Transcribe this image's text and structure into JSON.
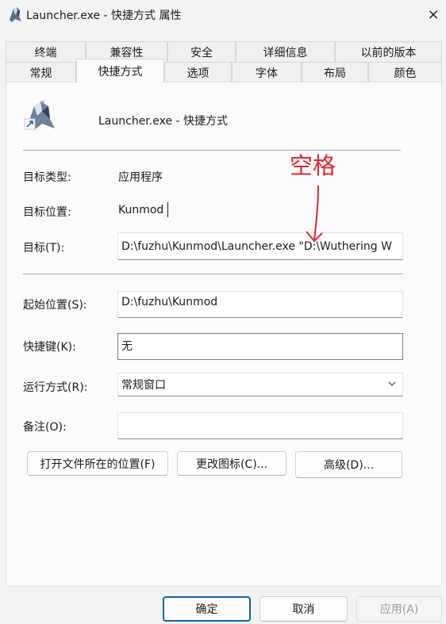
{
  "window": {
    "title": "Launcher.exe - 快捷方式 属性",
    "close_icon": "×"
  },
  "tabs_row_top": [
    "终端",
    "兼容性",
    "安全",
    "详细信息",
    "以前的版本"
  ],
  "tabs_row_bottom": [
    "常规",
    "快捷方式",
    "选项",
    "字体",
    "布局",
    "颜色"
  ],
  "active_tab": "快捷方式",
  "shortcut": {
    "name": "Launcher.exe - 快捷方式",
    "target_type_label": "目标类型:",
    "target_type_value": "应用程序",
    "target_location_label": "目标位置:",
    "target_location_value": "Kunmod",
    "target_label": "目标(T):",
    "target_value": "D:\\fuzhu\\Kunmod\\Launcher.exe \"D:\\Wuthering W",
    "start_in_label": "起始位置(S):",
    "start_in_value": "D:\\fuzhu\\Kunmod",
    "shortcut_key_label": "快捷键(K):",
    "shortcut_key_value": "无",
    "run_label": "运行方式(R):",
    "run_value": "常规窗口",
    "comment_label": "备注(O):",
    "comment_value": ""
  },
  "buttons": {
    "open_location": "打开文件所在的位置(F)",
    "change_icon": "更改图标(C)...",
    "advanced": "高级(D)...",
    "ok": "确定",
    "cancel": "取消",
    "apply": "应用(A)"
  },
  "annotation": {
    "text": "空格",
    "color": "#e3262f"
  },
  "colors": {
    "accent": "#0a64b4",
    "annotation": "#e3262f"
  }
}
